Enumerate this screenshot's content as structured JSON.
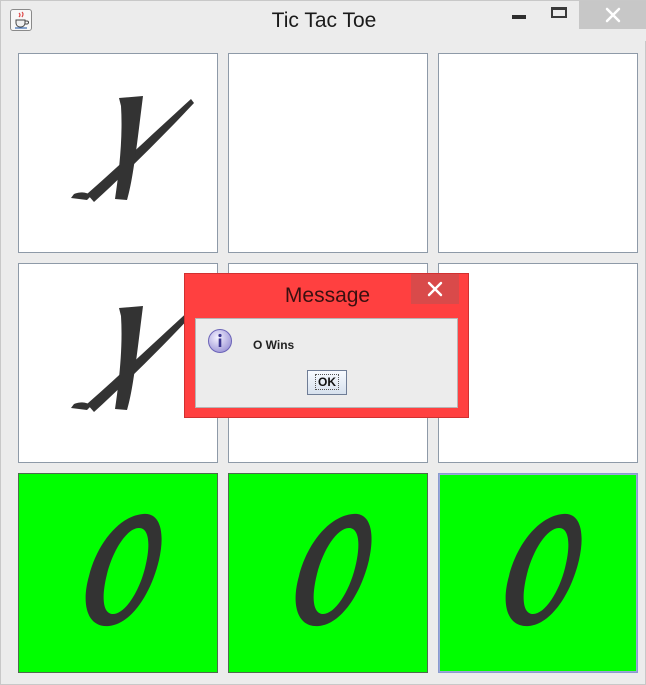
{
  "window": {
    "title": "Tic Tac Toe",
    "icon": "java-cup-icon",
    "controls": [
      "minimize-icon",
      "maximize-icon",
      "close-icon"
    ]
  },
  "board": {
    "cells": [
      {
        "mark": "X",
        "winning": false
      },
      {
        "mark": "",
        "winning": false
      },
      {
        "mark": "",
        "winning": false
      },
      {
        "mark": "X",
        "winning": false
      },
      {
        "mark": "",
        "winning": false
      },
      {
        "mark": "",
        "winning": false
      },
      {
        "mark": "O",
        "winning": true
      },
      {
        "mark": "O",
        "winning": true
      },
      {
        "mark": "O",
        "winning": true
      }
    ],
    "win_color": "#00ff00",
    "mark_color": "#333333"
  },
  "dialog": {
    "title": "Message",
    "message": "O Wins",
    "ok_label": "OK",
    "icon": "info-icon",
    "frame_color": "#ff4040"
  }
}
